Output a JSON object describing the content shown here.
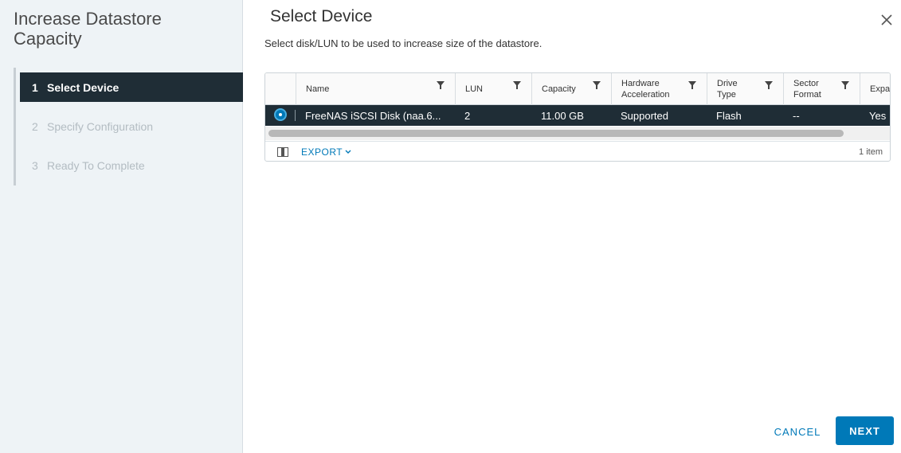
{
  "wizard": {
    "title": "Increase Datastore Capacity",
    "steps": [
      {
        "num": "1",
        "label": "Select Device",
        "state": "active"
      },
      {
        "num": "2",
        "label": "Specify Configuration",
        "state": "inactive"
      },
      {
        "num": "3",
        "label": "Ready To Complete",
        "state": "inactive"
      }
    ]
  },
  "page": {
    "title": "Select Device",
    "subtitle": "Select disk/LUN to be used to increase size of the datastore."
  },
  "table": {
    "columns": {
      "name": "Name",
      "lun": "LUN",
      "capacity": "Capacity",
      "hw_accel_1": "Hardware",
      "hw_accel_2": "Acceleration",
      "drive_type_1": "Drive",
      "drive_type_2": "Type",
      "sector_format_1": "Sector",
      "sector_format_2": "Format",
      "expand": "Expa"
    },
    "rows": [
      {
        "name": "FreeNAS iSCSI Disk (naa.6...",
        "lun": "2",
        "capacity": "11.00 GB",
        "hw_accel": "Supported",
        "drive_type": "Flash",
        "sector_format": "--",
        "expand": "Yes",
        "selected": true
      }
    ],
    "export_label": "EXPORT",
    "item_count": "1 item"
  },
  "buttons": {
    "cancel": "CANCEL",
    "next": "NEXT"
  },
  "colors": {
    "accent": "#0079b8",
    "selected_row": "#1f2d36",
    "sidebar_bg": "#eef3f6"
  },
  "icons": {
    "close": "close-icon",
    "filter": "filter-icon",
    "column_toggle": "column-toggle-icon",
    "chevron": "chevron-down-icon"
  }
}
